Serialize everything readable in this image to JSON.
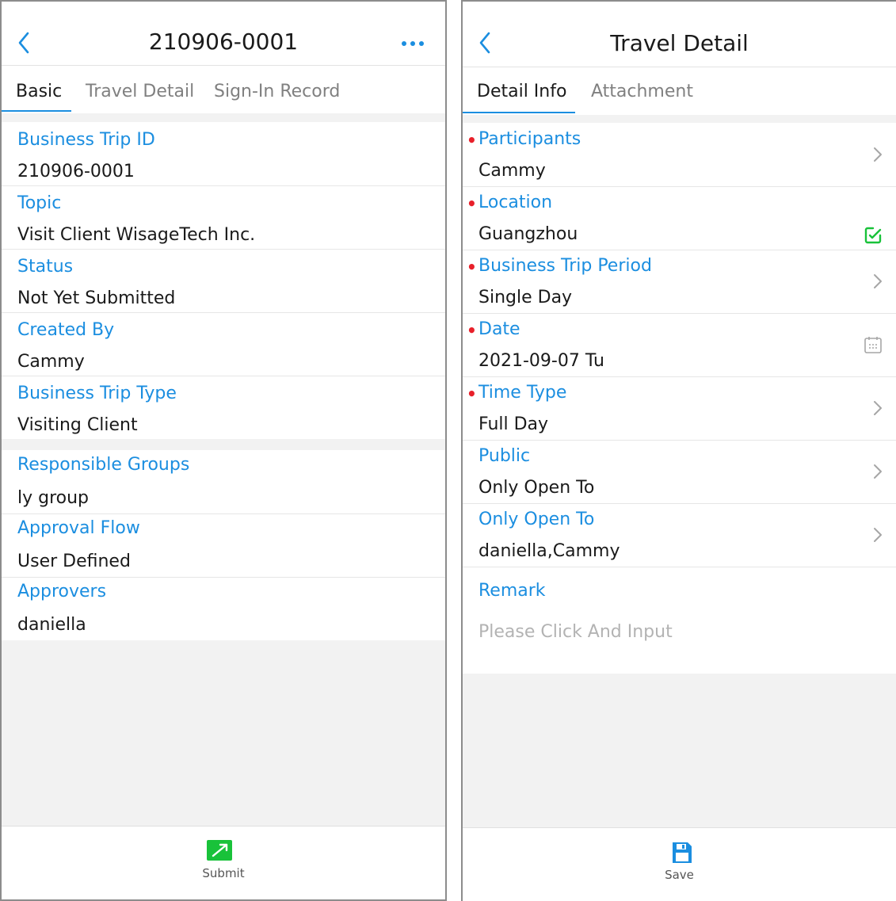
{
  "left": {
    "header": {
      "title": "210906-0001"
    },
    "tabs": [
      "Basic",
      "Travel Detail",
      "Sign-In Record"
    ],
    "section1": [
      {
        "label": "Business Trip ID",
        "value": "210906-0001"
      },
      {
        "label": "Topic",
        "value": "Visit Client WisageTech Inc."
      },
      {
        "label": "Status",
        "value": "Not Yet Submitted"
      },
      {
        "label": "Created By",
        "value": "Cammy"
      },
      {
        "label": "Business Trip Type",
        "value": "Visiting Client"
      }
    ],
    "section2": [
      {
        "label": "Responsible Groups",
        "value": "ly group"
      },
      {
        "label": "Approval Flow",
        "value": "User Defined"
      },
      {
        "label": "Approvers",
        "value": "daniella"
      }
    ],
    "footer": {
      "label": "Submit",
      "icon": "submit-icon",
      "color": "#19c23a"
    }
  },
  "right": {
    "header": {
      "title": "Travel Detail"
    },
    "tabs": [
      "Detail Info",
      "Attachment"
    ],
    "fields": [
      {
        "label": "Participants",
        "value": "Cammy",
        "required": true,
        "icon": "chevron-right-icon"
      },
      {
        "label": "Location",
        "value": "Guangzhou",
        "required": true,
        "icon": "edit-check-icon"
      },
      {
        "label": "Business Trip Period",
        "value": "Single Day",
        "required": true,
        "icon": "chevron-right-icon"
      },
      {
        "label": "Date",
        "value": "2021-09-07 Tu",
        "required": true,
        "icon": "calendar-icon"
      },
      {
        "label": "Time Type",
        "value": "Full Day",
        "required": true,
        "icon": "chevron-right-icon"
      },
      {
        "label": "Public",
        "value": "Only Open To",
        "required": false,
        "icon": "chevron-right-icon"
      },
      {
        "label": "Only Open To",
        "value": "daniella,Cammy",
        "required": false,
        "icon": "chevron-right-icon"
      }
    ],
    "remark": {
      "label": "Remark",
      "placeholder": "Please Click And Input"
    },
    "footer": {
      "label": "Save",
      "icon": "save-icon",
      "color": "#1b8ee0"
    }
  },
  "colors": {
    "accent": "#1b8ee0",
    "required": "#e8202a",
    "success": "#19c23a"
  }
}
